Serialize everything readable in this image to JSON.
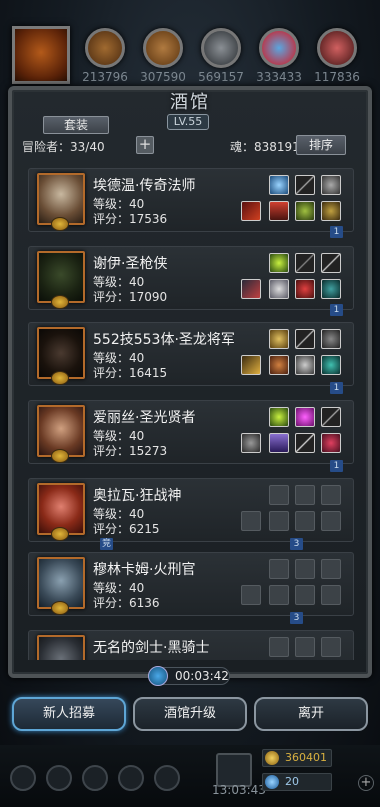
{
  "top_avatars": {
    "scores": [
      "213796",
      "307590",
      "569157",
      "333433",
      "117836"
    ]
  },
  "tavern": {
    "title": "酒馆",
    "level": "LV.55",
    "set_button": "套装",
    "adventurers": "冒险者：33/40",
    "plus": "+",
    "soul": "魂：838191",
    "sort_button": "排序"
  },
  "heroes": [
    {
      "name": "埃德温·传奇法师",
      "level": "等级：40",
      "score": "评分：17536",
      "tag": "1",
      "portrait_color": "#7a5c40"
    },
    {
      "name": "谢伊·圣枪侠",
      "level": "等级：40",
      "score": "评分：17090",
      "tag": "1",
      "portrait_color": "#2e3a22"
    },
    {
      "name": "552技553体·圣龙将军",
      "level": "等级：40",
      "score": "评分：16415",
      "tag": "1",
      "portrait_color": "#3a2a20"
    },
    {
      "name": "爱丽丝·圣光贤者",
      "level": "等级：40",
      "score": "评分：15273",
      "tag": "1",
      "portrait_color": "#6a4030"
    },
    {
      "name": "奥拉瓦·狂战神",
      "level": "等级：40",
      "score": "评分：6215",
      "tag": "3",
      "tag2": "竞",
      "portrait_color": "#7a2a1a"
    },
    {
      "name": "穆林卡姆·火刑官",
      "level": "等级：40",
      "score": "评分：6136",
      "tag": "3",
      "portrait_color": "#445a6a"
    },
    {
      "name": "无名的剑士·黑骑士",
      "level": "",
      "score": "",
      "tag": "",
      "portrait_color": "#3a3e44"
    }
  ],
  "timer": "00:03:42",
  "buttons": {
    "recruit": "新人招募",
    "upgrade": "酒馆升级",
    "leave": "离开"
  },
  "bottom": {
    "time": "13:03:43",
    "gold": "360401",
    "gems": "20"
  },
  "colors": {
    "accent_blue": "#5ea6d6",
    "gold": "#e0b63a",
    "tag_blue": "#264c88"
  }
}
